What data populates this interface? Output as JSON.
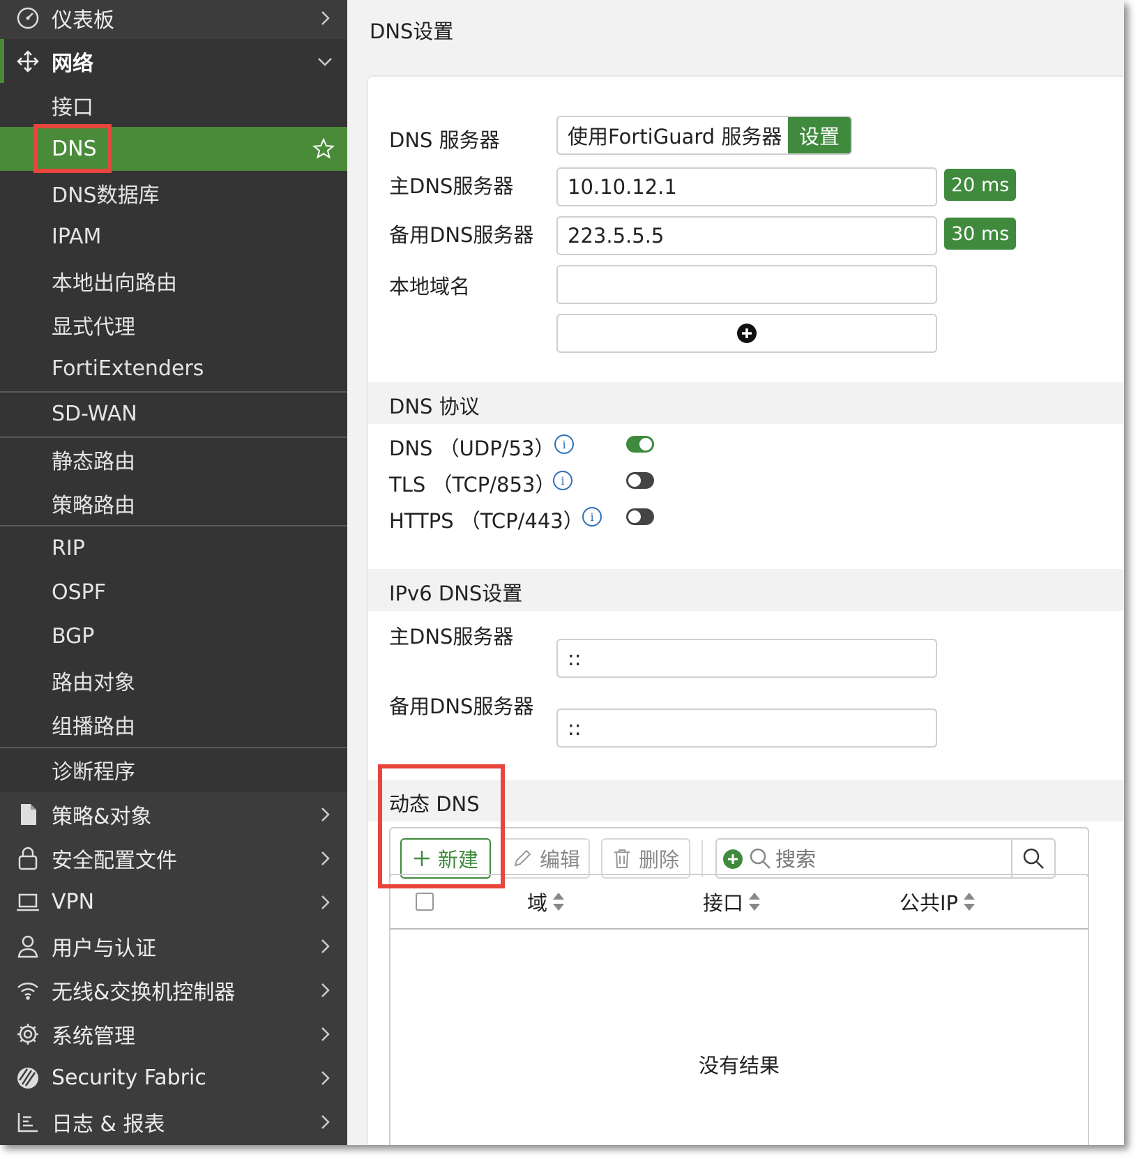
{
  "sidebar": {
    "dashboard": "仪表板",
    "network": "网络",
    "network_items": [
      "接口",
      "DNS",
      "DNS数据库",
      "IPAM",
      "本地出向路由",
      "显式代理",
      "FortiExtenders",
      "SD-WAN",
      "静态路由",
      "策略路由",
      "RIP",
      "OSPF",
      "BGP",
      "路由对象",
      "组播路由",
      "诊断程序"
    ],
    "sections": [
      "策略&对象",
      "安全配置文件",
      "VPN",
      "用户与认证",
      "无线&交换机控制器",
      "系统管理",
      "Security Fabric",
      "日志 & 报表"
    ],
    "active_color": "#4a8b3a"
  },
  "main": {
    "title": "DNS设置",
    "dns_server": {
      "label": "DNS 服务器",
      "option": "使用FortiGuard 服务器",
      "settings_btn": "设置"
    },
    "primary": {
      "label": "主DNS服务器",
      "value": "10.10.12.1",
      "latency": "20 ms"
    },
    "secondary": {
      "label": "备用DNS服务器",
      "value": "223.5.5.5",
      "latency": "30 ms"
    },
    "local_domain": {
      "label": "本地域名",
      "value": ""
    },
    "protocol": {
      "heading": "DNS 协议",
      "items": [
        {
          "label": "DNS （UDP/53）",
          "enabled": true
        },
        {
          "label": "TLS （TCP/853）",
          "enabled": false
        },
        {
          "label": "HTTPS （TCP/443）",
          "enabled": false
        }
      ]
    },
    "ipv6": {
      "heading": "IPv6 DNS设置",
      "primary_label": "主DNS服务器",
      "primary_value": "::",
      "secondary_label": "备用DNS服务器",
      "secondary_value": "::"
    },
    "ddns": {
      "heading": "动态 DNS",
      "new_btn": "新建",
      "edit_btn": "编辑",
      "delete_btn": "删除",
      "search_placeholder": "搜索",
      "columns": [
        "域",
        "接口",
        "公共IP"
      ],
      "empty_text": "没有结果"
    }
  },
  "colors": {
    "accent": "#3f8a3c",
    "highlight": "#e8453c"
  }
}
